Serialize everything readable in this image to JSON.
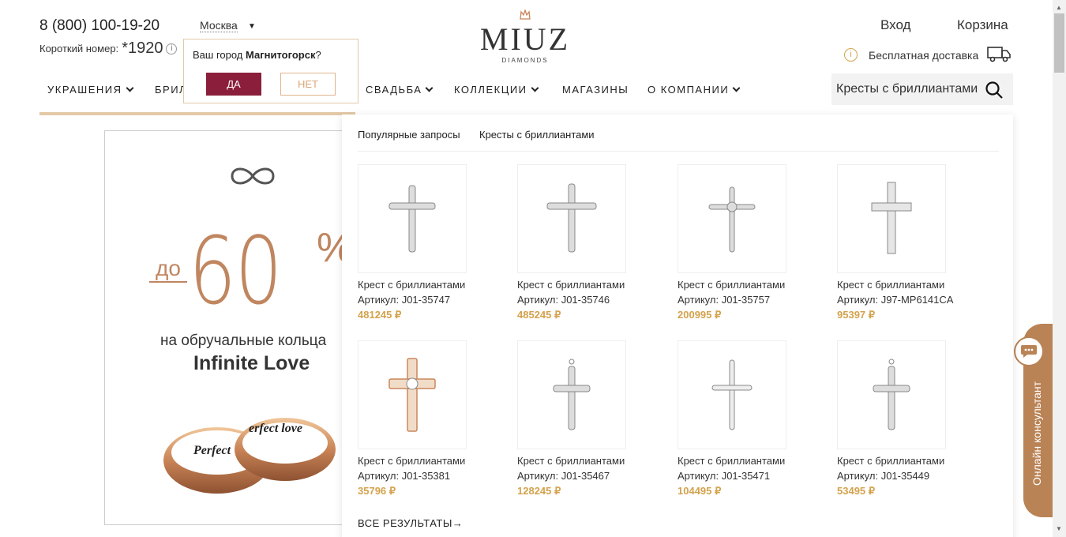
{
  "header": {
    "phone": "8 (800) 100-19-20",
    "short_label": "Короткий номер:",
    "short_number": "*1920",
    "city": "Москва",
    "login": "Вход",
    "cart": "Корзина",
    "delivery": "Бесплатная доставка"
  },
  "logo": {
    "brand": "MIUZ",
    "sub": "DIAMONDS"
  },
  "city_popup": {
    "question_prefix": "Ваш город ",
    "city": "Магнитогорск",
    "question_suffix": "?",
    "yes": "ДА",
    "no": "НЕТ"
  },
  "nav": [
    "УКРАШЕНИЯ",
    "БРИЛ",
    "СВАДЬБА",
    "КОЛЛЕКЦИИ",
    "МАГАЗИНЫ",
    "О КОМПАНИИ"
  ],
  "search": {
    "value": "Кресты с бриллиантами"
  },
  "banner": {
    "do": "до",
    "big": "60",
    "percent": "%",
    "line1": "на обручальные кольца",
    "line2": "Infinite Love",
    "engr1": "Perfect",
    "engr2": "erfect love"
  },
  "dropdown": {
    "popular_label": "Популярные запросы",
    "popular_query": "Кресты с бриллиантами",
    "all_results": "ВСЕ РЕЗУЛЬТАТЫ→",
    "products": [
      {
        "name": "Крест с бриллиантами",
        "article": "Артикул: J01-35747",
        "price": "481245 ₽"
      },
      {
        "name": "Крест с бриллиантами",
        "article": "Артикул: J01-35746",
        "price": "485245 ₽"
      },
      {
        "name": "Крест с бриллиантами",
        "article": "Артикул: J01-35757",
        "price": "200995 ₽"
      },
      {
        "name": "Крест с бриллиантами",
        "article": "Артикул: J97-MP6141CA",
        "price": "95397 ₽"
      },
      {
        "name": "Крест с бриллиантами",
        "article": "Артикул: J01-35381",
        "price": "35796 ₽"
      },
      {
        "name": "Крест с бриллиантами",
        "article": "Артикул: J01-35467",
        "price": "128245 ₽"
      },
      {
        "name": "Крест с бриллиантами",
        "article": "Артикул: J01-35471",
        "price": "104495 ₽"
      },
      {
        "name": "Крест с бриллиантами",
        "article": "Артикул: J01-35449",
        "price": "53495 ₽"
      }
    ]
  },
  "consultant": {
    "label": "Онлайн консультант"
  },
  "colors": {
    "accent": "#c08660",
    "price": "#d4a24c",
    "button": "#8b1f3b"
  }
}
